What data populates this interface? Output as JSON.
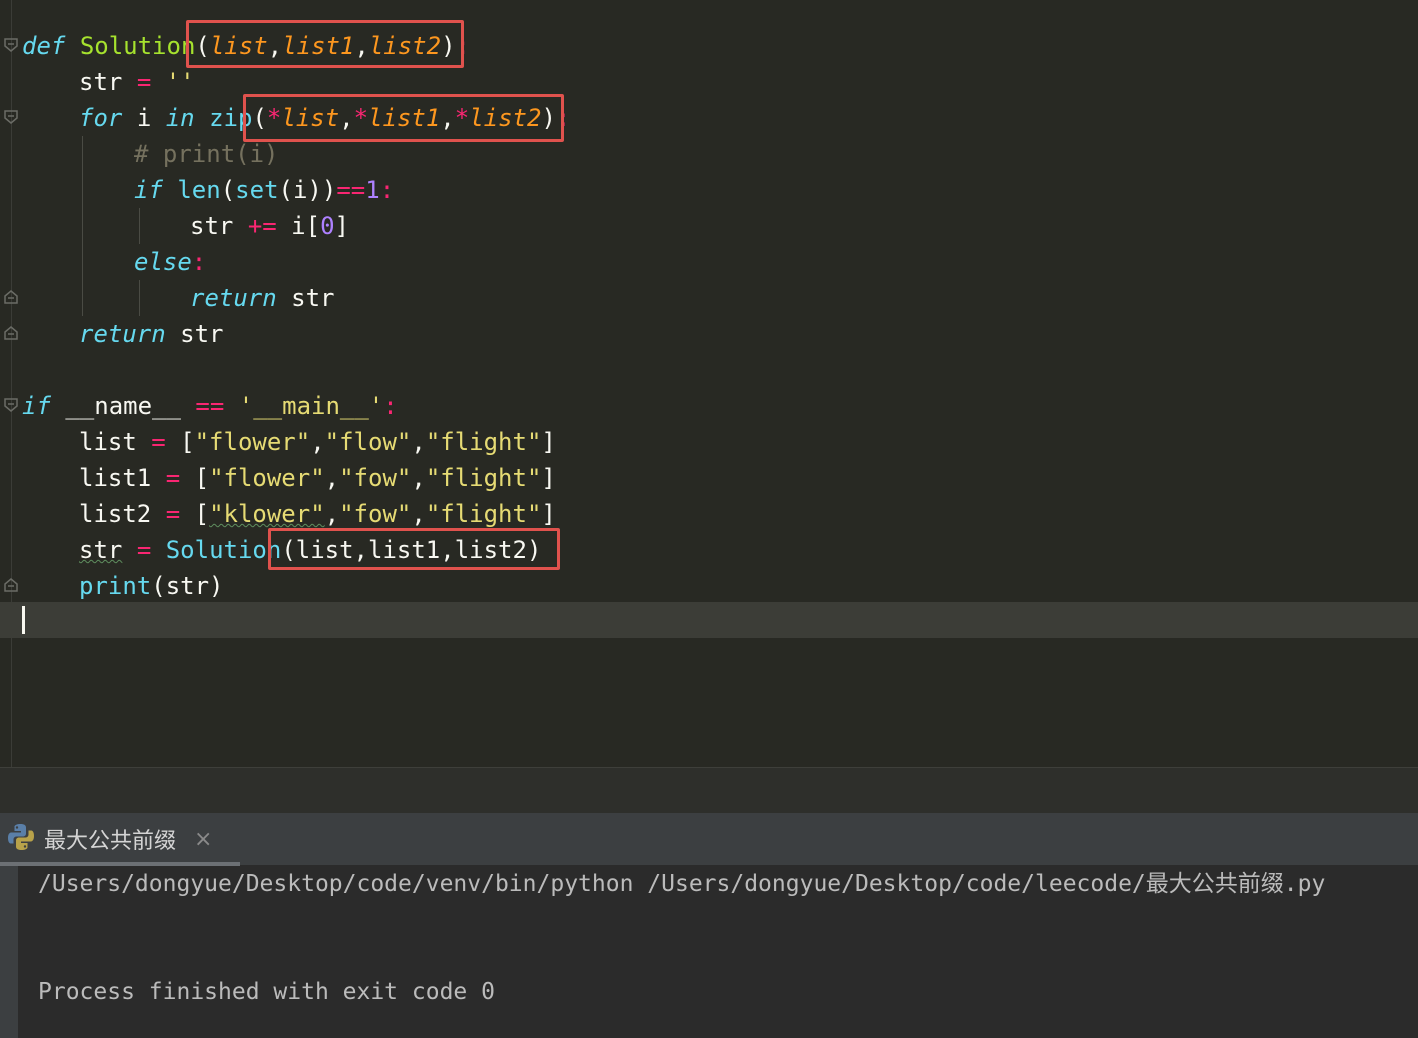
{
  "editor": {
    "code": {
      "def_kw": "def",
      "func_name": "Solution",
      "open_paren": "(",
      "param_list": "list",
      "comma": ",",
      "param_list1": "list1",
      "param_list2": "list2",
      "close_paren": ")",
      "colon": ":",
      "str_var": "str",
      "assign": "=",
      "empty_str": "''",
      "for_kw": "for",
      "loop_var": "i",
      "in_kw": "in",
      "zip_fn": "zip",
      "star": "*",
      "comment": "# print(i)",
      "if_kw": "if",
      "len_fn": "len",
      "set_fn": "set",
      "set_arg": "(i))",
      "eq": "==",
      "one": "1",
      "plus_eq": "+=",
      "index_open": "i[",
      "zero": "0",
      "index_close": "]",
      "else_kw": "else",
      "return_kw": "return",
      "name_dunder": "__name__",
      "main_str": "'__main__'",
      "list_var": "list",
      "list1_var": "list1",
      "list2_var": "list2",
      "bracket_open": "[",
      "bracket_close": "]",
      "s_flower": "\"flower\"",
      "s_flow": "\"flow\"",
      "s_flight": "\"flight\"",
      "s_fow": "\"fow\"",
      "s_klower": "\"klower\"",
      "call_args": "(list,list1,list2)",
      "print_fn": "print",
      "print_args": "(str)"
    },
    "colors": {
      "background": "#282923",
      "keyword": "#66d9ef",
      "class_name": "#a6e22e",
      "parameter": "#fd971f",
      "operator": "#f92672",
      "string": "#e6db74",
      "number": "#ae81ff",
      "highlight_box": "#e0524d"
    }
  },
  "run_panel": {
    "tab_label": "最大公共前缀",
    "tab_icon": "python-icon",
    "close_glyph": "×",
    "console_lines": [
      "/Users/dongyue/Desktop/code/venv/bin/python /Users/dongyue/Desktop/code/leecode/最大公共前缀.py",
      "Process finished with exit code 0"
    ]
  }
}
